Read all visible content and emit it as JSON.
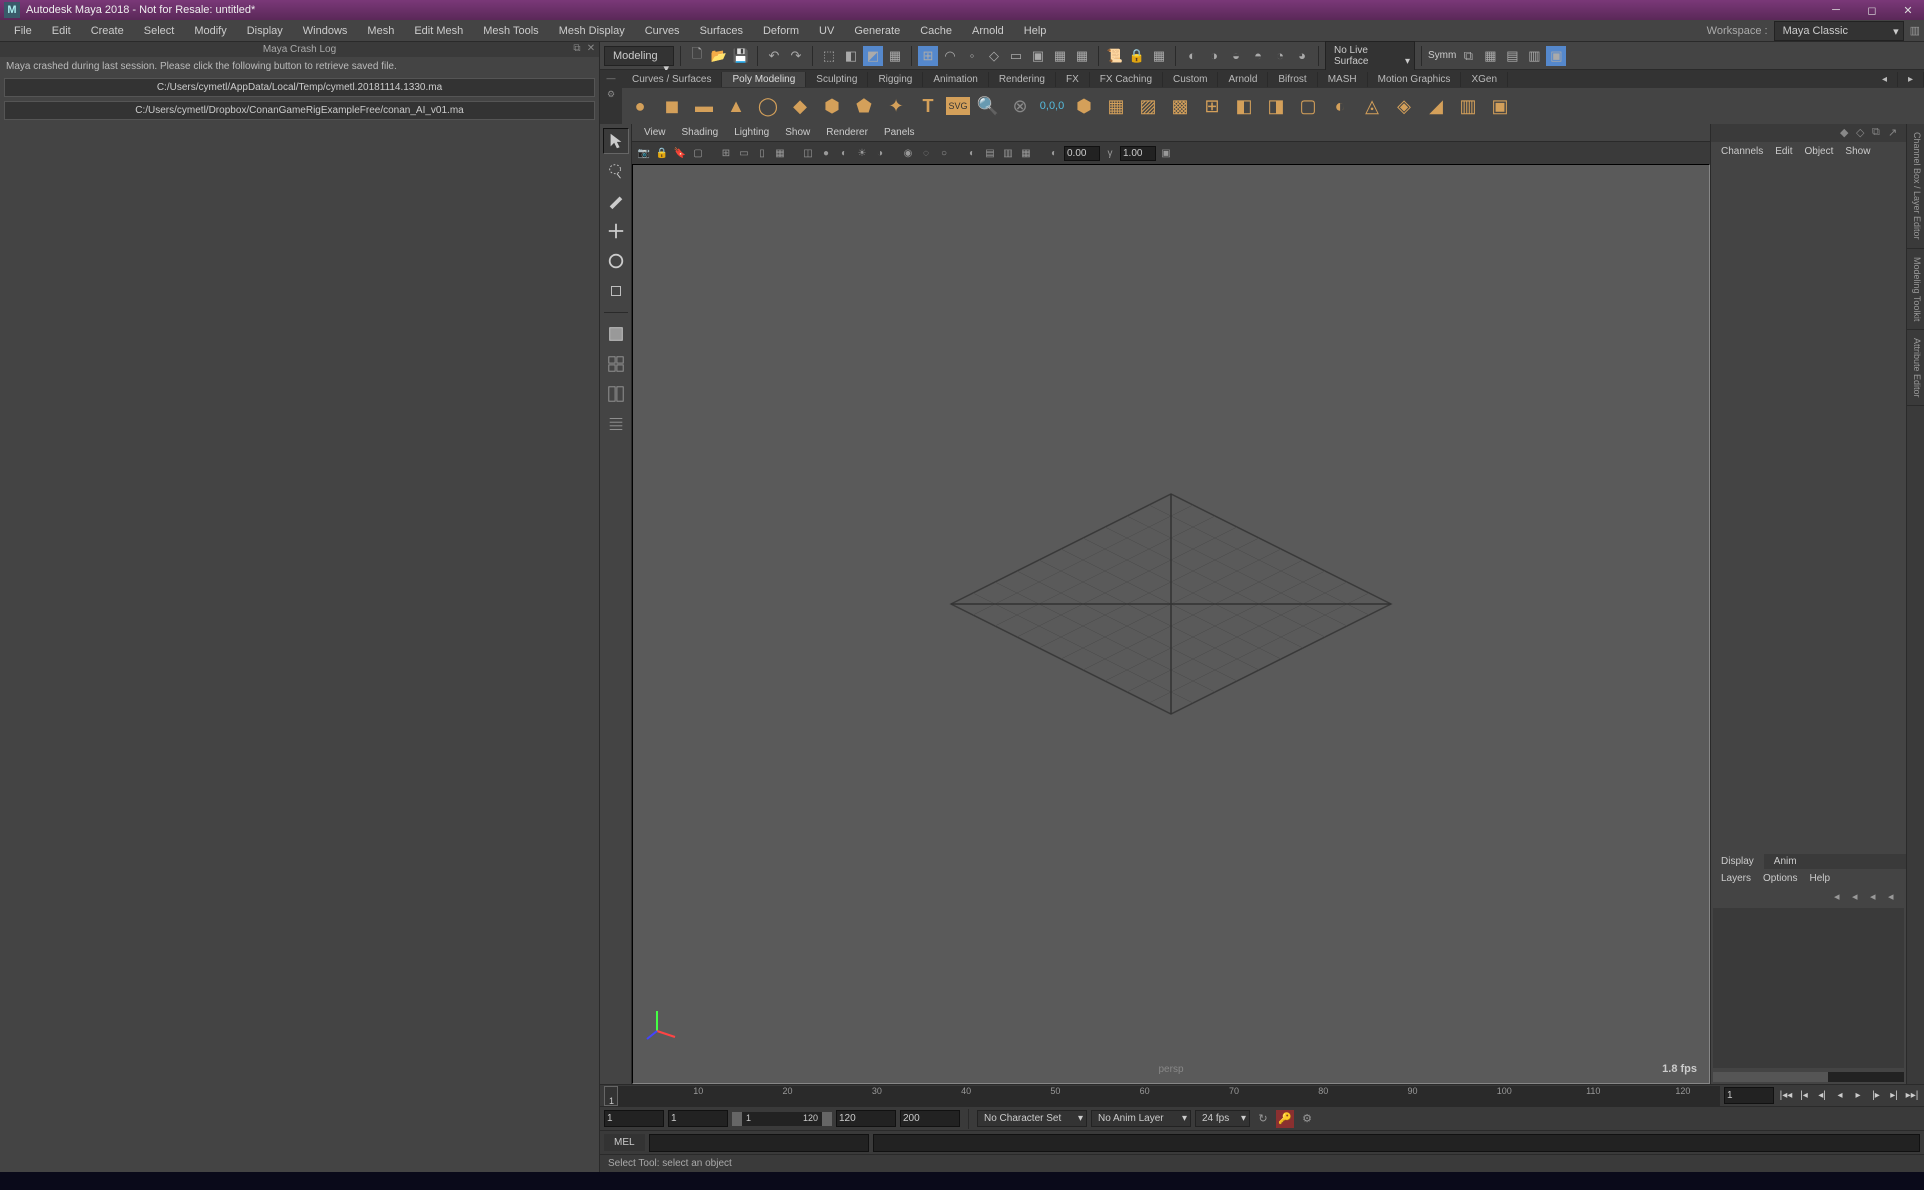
{
  "titlebar": {
    "title": "Autodesk Maya 2018 - Not for Resale: untitled*",
    "logo": "M"
  },
  "menubar": {
    "items": [
      "File",
      "Edit",
      "Create",
      "Select",
      "Modify",
      "Display",
      "Windows",
      "Mesh",
      "Edit Mesh",
      "Mesh Tools",
      "Mesh Display",
      "Curves",
      "Surfaces",
      "Deform",
      "UV",
      "Generate",
      "Cache",
      "Arnold",
      "Help"
    ],
    "workspace_label": "Workspace :",
    "workspace_value": "Maya Classic"
  },
  "crash": {
    "header": "Maya Crash Log",
    "message": "Maya crashed during last session. Please click the following button to retrieve saved file.",
    "files": [
      "C:/Users/cymetl/AppData/Local/Temp/cymetl.20181114.1330.ma",
      "C:/Users/cymetl/Dropbox/ConanGameRigExampleFree/conan_AI_v01.ma"
    ]
  },
  "toolbar": {
    "mode": "Modeling",
    "live_surface": "No Live Surface",
    "symmetry": "Symm"
  },
  "shelf": {
    "tabs": [
      "Curves / Surfaces",
      "Poly Modeling",
      "Sculpting",
      "Rigging",
      "Animation",
      "Rendering",
      "FX",
      "FX Caching",
      "Custom",
      "Arnold",
      "Bifrost",
      "MASH",
      "Motion Graphics",
      "XGen"
    ],
    "active_tab": 1
  },
  "viewport": {
    "menus": [
      "View",
      "Shading",
      "Lighting",
      "Show",
      "Renderer",
      "Panels"
    ],
    "exposure": "0.00",
    "gamma": "1.00",
    "camera": "persp",
    "fps": "1.8 fps"
  },
  "channel_box": {
    "menus": [
      "Channels",
      "Edit",
      "Object",
      "Show"
    ],
    "layer_tabs": [
      "Display",
      "Anim"
    ],
    "layer_menus": [
      "Layers",
      "Options",
      "Help"
    ]
  },
  "sidebar_tabs": [
    "Channel Box / Layer Editor",
    "Modeling Toolkit",
    "Attribute Editor"
  ],
  "timeline": {
    "ticks": [
      "1",
      "10",
      "20",
      "30",
      "40",
      "50",
      "60",
      "70",
      "80",
      "90",
      "100",
      "110",
      "120"
    ],
    "current_frame": "1"
  },
  "range": {
    "start": "1",
    "range_start": "1",
    "range_cur": "1",
    "range_end": "120",
    "end_a": "120",
    "end_b": "200",
    "char_set": "No Character Set",
    "anim_layer": "No Anim Layer",
    "fps": "24 fps"
  },
  "cmd": {
    "label": "MEL"
  },
  "status": {
    "text": "Select Tool: select an object"
  }
}
